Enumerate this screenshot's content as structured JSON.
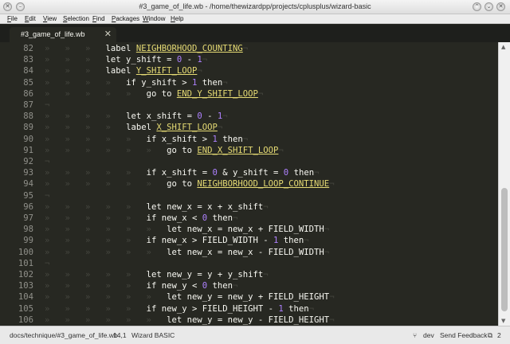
{
  "window": {
    "title": "#3_game_of_life.wb - /home/thewizardpp/projects/cplusplus/wizard-basic",
    "min_glyph": "–",
    "close_glyph": "✕",
    "right_glyphs": [
      "⌃",
      "⌄",
      "✕"
    ]
  },
  "menu": [
    "File",
    "Edit",
    "View",
    "Selection",
    "Find",
    "Packages",
    "Window",
    "Help"
  ],
  "tab": {
    "label": "#3_game_of_life.wb",
    "close": "✕"
  },
  "editor": {
    "lines": [
      {
        "n": "82",
        "indent": 3,
        "tokens": [
          [
            "kw",
            "label "
          ],
          [
            "lbl",
            "NEIGHBORHOOD_COUNTING"
          ]
        ]
      },
      {
        "n": "83",
        "indent": 3,
        "tokens": [
          [
            "kw",
            "let y_shift = "
          ],
          [
            "num",
            "0"
          ],
          [
            "op",
            " - "
          ],
          [
            "num",
            "1"
          ]
        ]
      },
      {
        "n": "84",
        "indent": 3,
        "tokens": [
          [
            "kw",
            "label "
          ],
          [
            "lbl",
            "Y_SHIFT_LOOP"
          ]
        ]
      },
      {
        "n": "85",
        "indent": 4,
        "tokens": [
          [
            "kw",
            "if y_shift > "
          ],
          [
            "num",
            "1"
          ],
          [
            "kw",
            " then"
          ]
        ]
      },
      {
        "n": "86",
        "indent": 5,
        "tokens": [
          [
            "kw",
            "go to "
          ],
          [
            "lbl",
            "END_Y_SHIFT_LOOP"
          ]
        ]
      },
      {
        "n": "87",
        "indent": 0,
        "tokens": []
      },
      {
        "n": "88",
        "indent": 4,
        "tokens": [
          [
            "kw",
            "let x_shift = "
          ],
          [
            "num",
            "0"
          ],
          [
            "op",
            " - "
          ],
          [
            "num",
            "1"
          ]
        ]
      },
      {
        "n": "89",
        "indent": 4,
        "tokens": [
          [
            "kw",
            "label "
          ],
          [
            "lbl",
            "X_SHIFT_LOOP"
          ]
        ]
      },
      {
        "n": "90",
        "indent": 5,
        "tokens": [
          [
            "kw",
            "if x_shift > "
          ],
          [
            "num",
            "1"
          ],
          [
            "kw",
            " then"
          ]
        ]
      },
      {
        "n": "91",
        "indent": 6,
        "tokens": [
          [
            "kw",
            "go to "
          ],
          [
            "lbl",
            "END_X_SHIFT_LOOP"
          ]
        ]
      },
      {
        "n": "92",
        "indent": 0,
        "tokens": []
      },
      {
        "n": "93",
        "indent": 5,
        "tokens": [
          [
            "kw",
            "if x_shift = "
          ],
          [
            "num",
            "0"
          ],
          [
            "kw",
            " & y_shift = "
          ],
          [
            "num",
            "0"
          ],
          [
            "kw",
            " then"
          ]
        ]
      },
      {
        "n": "94",
        "indent": 6,
        "tokens": [
          [
            "kw",
            "go to "
          ],
          [
            "lbl",
            "NEIGHBORHOOD_LOOP_CONTINUE"
          ]
        ]
      },
      {
        "n": "95",
        "indent": 0,
        "tokens": []
      },
      {
        "n": "96",
        "indent": 5,
        "tokens": [
          [
            "kw",
            "let new_x = x + x_shift"
          ]
        ]
      },
      {
        "n": "97",
        "indent": 5,
        "tokens": [
          [
            "kw",
            "if new_x < "
          ],
          [
            "num",
            "0"
          ],
          [
            "kw",
            " then"
          ]
        ]
      },
      {
        "n": "98",
        "indent": 6,
        "tokens": [
          [
            "kw",
            "let new_x = new_x + FIELD_WIDTH"
          ]
        ]
      },
      {
        "n": "99",
        "indent": 5,
        "tokens": [
          [
            "kw",
            "if new_x > FIELD_WIDTH - "
          ],
          [
            "num",
            "1"
          ],
          [
            "kw",
            " then"
          ]
        ]
      },
      {
        "n": "100",
        "indent": 6,
        "tokens": [
          [
            "kw",
            "let new_x = new_x - FIELD_WIDTH"
          ]
        ]
      },
      {
        "n": "101",
        "indent": 0,
        "tokens": []
      },
      {
        "n": "102",
        "indent": 5,
        "tokens": [
          [
            "kw",
            "let new_y = y + y_shift"
          ]
        ]
      },
      {
        "n": "103",
        "indent": 5,
        "tokens": [
          [
            "kw",
            "if new_y < "
          ],
          [
            "num",
            "0"
          ],
          [
            "kw",
            " then"
          ]
        ]
      },
      {
        "n": "104",
        "indent": 6,
        "tokens": [
          [
            "kw",
            "let new_y = new_y + FIELD_HEIGHT"
          ]
        ]
      },
      {
        "n": "105",
        "indent": 5,
        "tokens": [
          [
            "kw",
            "if new_y > FIELD_HEIGHT - "
          ],
          [
            "num",
            "1"
          ],
          [
            "kw",
            " then"
          ]
        ]
      },
      {
        "n": "106",
        "indent": 6,
        "tokens": [
          [
            "kw",
            "let new_y = new_y - FIELD_HEIGHT"
          ]
        ]
      }
    ]
  },
  "status": {
    "path": "docs/technique/#3_game_of_life.wb",
    "cursor": "14,1",
    "grammar": "Wizard BASIC",
    "branch_icon": "git-branch-icon",
    "branch": "dev",
    "feedback": "Send Feedback",
    "updates_icon": "package-updates-icon",
    "updates": "2"
  },
  "colors": {
    "background": "#272822",
    "label": "#e6db74",
    "number": "#ae81ff",
    "invisible": "#45463f"
  }
}
